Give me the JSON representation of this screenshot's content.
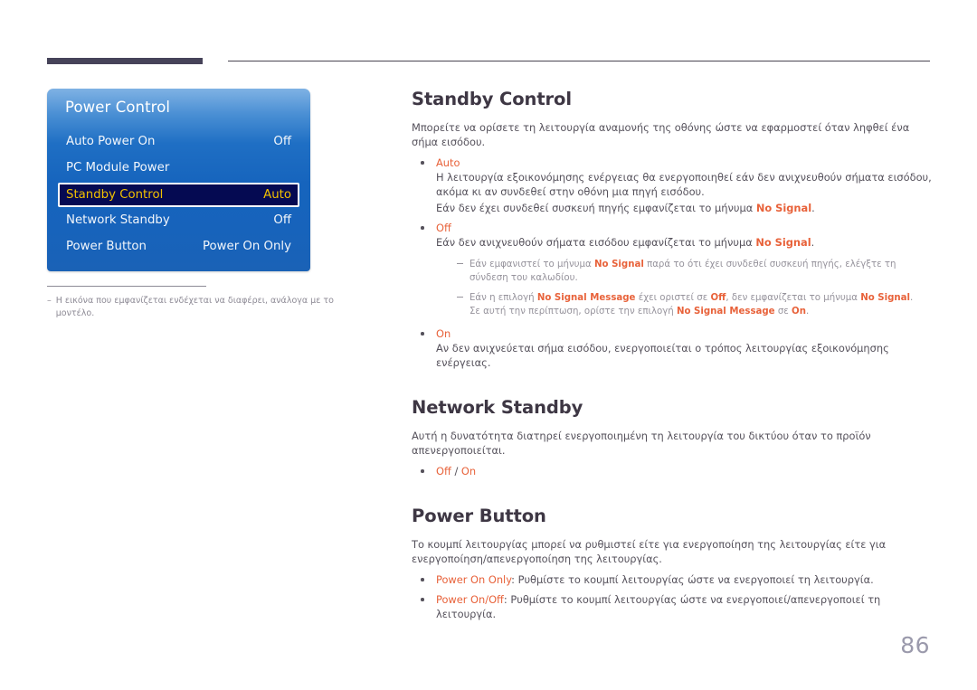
{
  "page": {
    "number": "86"
  },
  "osd": {
    "title": "Power Control",
    "rows": [
      {
        "label": "Auto Power On",
        "value": "Off",
        "selected": false
      },
      {
        "label": "PC Module Power",
        "value": "",
        "selected": false
      },
      {
        "label": "Standby Control",
        "value": "Auto",
        "selected": true
      },
      {
        "label": "Network Standby",
        "value": "Off",
        "selected": false
      },
      {
        "label": "Power Button",
        "value": "Power On Only",
        "selected": false
      }
    ]
  },
  "left_note": {
    "dash": "–",
    "text": "Η εικόνα που εμφανίζεται ενδέχεται να διαφέρει, ανάλογα με το μοντέλο."
  },
  "sections": {
    "standby_control": {
      "heading": "Standby Control",
      "intro": "Μπορείτε να ορίσετε τη λειτουργία αναμονής της οθόνης ώστε να εφαρμοστεί όταν ληφθεί ένα σήμα εισόδου.",
      "auto": {
        "option": "Auto",
        "line1": "Η λειτουργία εξοικονόμησης ενέργειας θα ενεργοποιηθεί εάν δεν ανιχνευθούν σήματα εισόδου, ακόμα κι αν συνδεθεί στην οθόνη μια πηγή εισόδου.",
        "line2_a": "Εάν δεν έχει συνδεθεί συσκευή πηγής εμφανίζεται το μήνυμα ",
        "line2_hl": "No Signal",
        "line2_b": "."
      },
      "off": {
        "option": "Off",
        "line1_a": "Εάν δεν ανιχνευθούν σήματα εισόδου εμφανίζεται το μήνυμα ",
        "line1_hl": "No Signal",
        "line1_b": "."
      },
      "notes": [
        {
          "a": "Εάν εμφανιστεί το μήνυμα ",
          "hl1": "No Signal",
          "b": " παρά το ότι έχει συνδεθεί συσκευή πηγής, ελέγξτε τη σύνδεση του καλωδίου."
        },
        {
          "a": "Εάν η επιλογή ",
          "hl1": "No Signal Message",
          "b": " έχει οριστεί σε ",
          "hl2": "Off",
          "c": ", δεν εμφανίζεται το μήνυμα ",
          "hl3": "No Signal",
          "d": ".",
          "e": "Σε αυτή την περίπτωση, ορίστε την επιλογή ",
          "hl4": "No Signal Message",
          "f": " σε ",
          "hl5": "On",
          "g": "."
        }
      ],
      "on": {
        "option": "On",
        "line1": "Αν δεν ανιχνεύεται σήμα εισόδου, ενεργοποιείται ο τρόπος λειτουργίας εξοικονόμησης ενέργειας."
      }
    },
    "network_standby": {
      "heading": "Network Standby",
      "intro": "Αυτή η δυνατότητα διατηρεί ενεργοποιημένη τη λειτουργία του δικτύου όταν το προϊόν απενεργοποιείται.",
      "option_off": "Off",
      "separator": " / ",
      "option_on": "On"
    },
    "power_button": {
      "heading": "Power Button",
      "intro": "Το κουμπί λειτουργίας μπορεί να ρυθμιστεί είτε για ενεργοποίηση της λειτουργίας είτε για ενεργοποίηση/απενεργοποίηση της λειτουργίας.",
      "items": [
        {
          "option": "Power On Only",
          "desc": ": Ρυθμίστε το κουμπί λειτουργίας ώστε να ενεργοποιεί τη λειτουργία."
        },
        {
          "option": "Power On/Off",
          "desc": ": Ρυθμίστε το κουμπί λειτουργίας ώστε να ενεργοποιεί/απενεργοποιεί τη λειτουργία."
        }
      ]
    }
  },
  "colors": {
    "accent": "#e8623a",
    "heading": "#3e3744",
    "osd_selected_text": "#f2c100",
    "osd_selected_bg": "#050a52",
    "rule": "#464359"
  }
}
